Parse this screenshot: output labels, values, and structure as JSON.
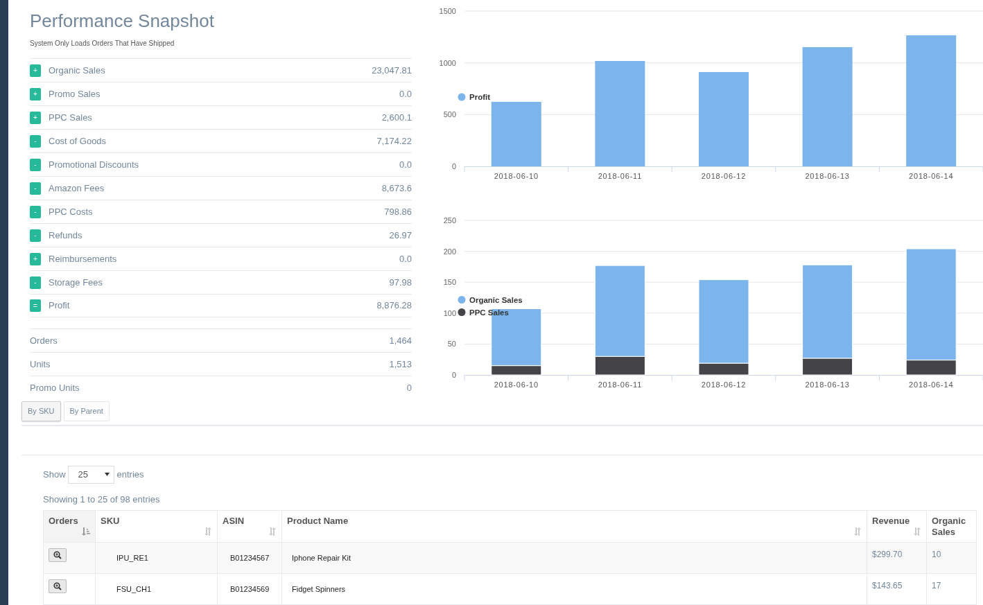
{
  "page": {
    "title": "Performance Snapshot",
    "subtitle": "System Only Loads Orders That Have Shipped"
  },
  "summary": [
    {
      "sign": "+",
      "label": "Organic Sales",
      "value": "23,047.81"
    },
    {
      "sign": "+",
      "label": "Promo Sales",
      "value": "0.0"
    },
    {
      "sign": "+",
      "label": "PPC Sales",
      "value": "2,600.1"
    },
    {
      "sign": "-",
      "label": "Cost of Goods",
      "value": "7,174.22"
    },
    {
      "sign": "-",
      "label": "Promotional Discounts",
      "value": "0.0"
    },
    {
      "sign": "-",
      "label": "Amazon Fees",
      "value": "8,673.6"
    },
    {
      "sign": "-",
      "label": "PPC Costs",
      "value": "798.86"
    },
    {
      "sign": "-",
      "label": "Refunds",
      "value": "26.97"
    },
    {
      "sign": "+",
      "label": "Reimbursements",
      "value": "0.0"
    },
    {
      "sign": "-",
      "label": "Storage Fees",
      "value": "97.98"
    },
    {
      "sign": "=",
      "label": "Profit",
      "value": "8,876.28"
    }
  ],
  "counts": [
    {
      "label": "Orders",
      "value": "1,464"
    },
    {
      "label": "Units",
      "value": "1,513"
    },
    {
      "label": "Promo Units",
      "value": "0"
    }
  ],
  "charts": [
    {
      "chart_data": {
        "type": "bar",
        "categories": [
          "2018-06-10",
          "2018-06-11",
          "2018-06-12",
          "2018-06-13",
          "2018-06-14"
        ],
        "series": [
          {
            "name": "Profit",
            "color": "#7cb5ec",
            "values": [
              623,
              1018,
              911,
              1152,
              1266
            ]
          }
        ],
        "ylim": [
          0,
          1500
        ],
        "yticks": [
          0,
          500,
          1000,
          1500
        ],
        "grid": true,
        "legend": "left"
      }
    },
    {
      "chart_data": {
        "type": "bar",
        "stacked": true,
        "categories": [
          "2018-06-10",
          "2018-06-11",
          "2018-06-12",
          "2018-06-13",
          "2018-06-14"
        ],
        "series": [
          {
            "name": "Organic Sales",
            "color": "#7cb5ec",
            "values": [
              92,
              147,
              135,
              151,
              180
            ]
          },
          {
            "name": "PPC Sales",
            "color": "#434348",
            "values": [
              15,
              30,
              19,
              27,
              24
            ]
          }
        ],
        "ylim": [
          0,
          250
        ],
        "yticks": [
          0,
          50,
          100,
          150,
          200,
          250
        ],
        "grid": true,
        "legend": "left"
      }
    }
  ],
  "view_tabs": [
    {
      "label": "By SKU",
      "selected": true
    },
    {
      "label": "By Parent",
      "selected": false
    }
  ],
  "length_menu": {
    "prefix": "Show",
    "value": "25",
    "suffix": "entries"
  },
  "info": "Showing 1 to 25 of 98 entries",
  "table": {
    "columns": [
      {
        "label": "Orders",
        "kind": "action",
        "sortable": true,
        "sorted": true
      },
      {
        "label": "SKU",
        "sortable": true,
        "sorted": false
      },
      {
        "label": "ASIN",
        "sortable": true,
        "sorted": false
      },
      {
        "label": "Product Name",
        "sortable": true,
        "sorted": false
      },
      {
        "label": "Revenue",
        "sortable": true,
        "sorted": false
      },
      {
        "label": "Organic Sales",
        "sortable": false,
        "sorted": false
      }
    ],
    "rows": [
      {
        "cells": [
          "",
          "IPU_RE1",
          "B01234567",
          "Iphone Repair Kit",
          "$299.70",
          "10"
        ]
      },
      {
        "cells": [
          "",
          "FSU_CH1",
          "B01234569",
          "Fidget Spinners",
          "$143.65",
          "17"
        ]
      }
    ]
  }
}
